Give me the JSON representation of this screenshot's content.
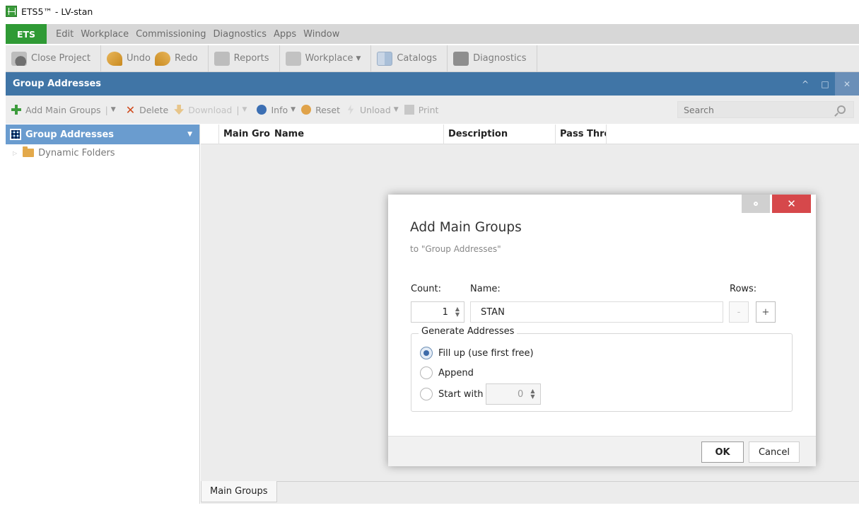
{
  "window": {
    "title": "ETS5™ - LV-stan"
  },
  "menu": {
    "ets": "ETS",
    "items": [
      "Edit",
      "Workplace",
      "Commissioning",
      "Diagnostics",
      "Apps",
      "Window"
    ]
  },
  "toolbar": {
    "close_project": "Close Project",
    "undo": "Undo",
    "redo": "Redo",
    "reports": "Reports",
    "workplace": "Workplace",
    "catalogs": "Catalogs",
    "diagnostics": "Diagnostics"
  },
  "panel": {
    "title": "Group Addresses",
    "toolbar": {
      "add_main_groups": "Add Main Groups",
      "delete": "Delete",
      "download": "Download",
      "info": "Info",
      "reset": "Reset",
      "unload": "Unload",
      "print": "Print",
      "search_placeholder": "Search"
    }
  },
  "tree": {
    "header": "Group Addresses",
    "items": [
      {
        "label": "Dynamic Folders"
      }
    ]
  },
  "grid": {
    "columns": [
      "Main Grou",
      "Name",
      "Description",
      "Pass Throu"
    ]
  },
  "bottom_tabs": [
    "Main Groups"
  ],
  "dialog": {
    "title": "Add Main Groups",
    "subtitle": "to \"Group Addresses\"",
    "count_label": "Count:",
    "count_value": "1",
    "name_label": "Name:",
    "name_value": "STAN",
    "rows_label": "Rows:",
    "rows_minus": "-",
    "rows_plus": "+",
    "generate_legend": "Generate Addresses",
    "options": [
      {
        "label": "Fill up (use first free)",
        "checked": true
      },
      {
        "label": "Append",
        "checked": false
      },
      {
        "label": "Start with",
        "checked": false
      }
    ],
    "start_with_value": "0",
    "ok": "OK",
    "cancel": "Cancel"
  }
}
